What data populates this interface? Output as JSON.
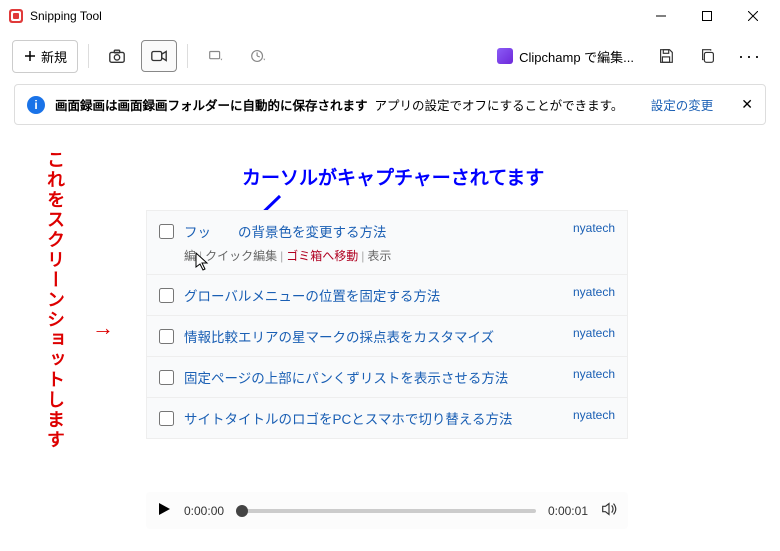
{
  "window": {
    "title": "Snipping Tool"
  },
  "toolbar": {
    "new_label": "新規",
    "clipchamp_label": "Clipchamp で編集..."
  },
  "banner": {
    "message_bold": "画面録画は画面録画フォルダーに自動的に保存されます",
    "message_rest": "アプリの設定でオフにすることができます。",
    "settings_link": "設定の変更"
  },
  "annotations": {
    "vertical": "これをスクリーンショットします",
    "top": "カーソルがキャプチャーされてます",
    "arrow_h": "→"
  },
  "posts": [
    {
      "title": "フッターの背景色を変更する方法",
      "title_pre": "フッ",
      "title_post": "の背景色を変更する方法",
      "author": "nyatech",
      "has_sub": true,
      "sub_edit": "編",
      "sub_quick": "クイック編集",
      "sub_trash": "ゴミ箱へ移動",
      "sub_view": "表示"
    },
    {
      "title": "グローバルメニューの位置を固定する方法",
      "author": "nyatech",
      "has_sub": false
    },
    {
      "title": "情報比較エリアの星マークの採点表をカスタマイズ",
      "author": "nyatech",
      "has_sub": false
    },
    {
      "title": "固定ページの上部にパンくずリストを表示させる方法",
      "author": "nyatech",
      "has_sub": false
    },
    {
      "title": "サイトタイトルのロゴをPCとスマホで切り替える方法",
      "author": "nyatech",
      "has_sub": false
    }
  ],
  "player": {
    "current": "0:00:00",
    "total": "0:00:01"
  }
}
